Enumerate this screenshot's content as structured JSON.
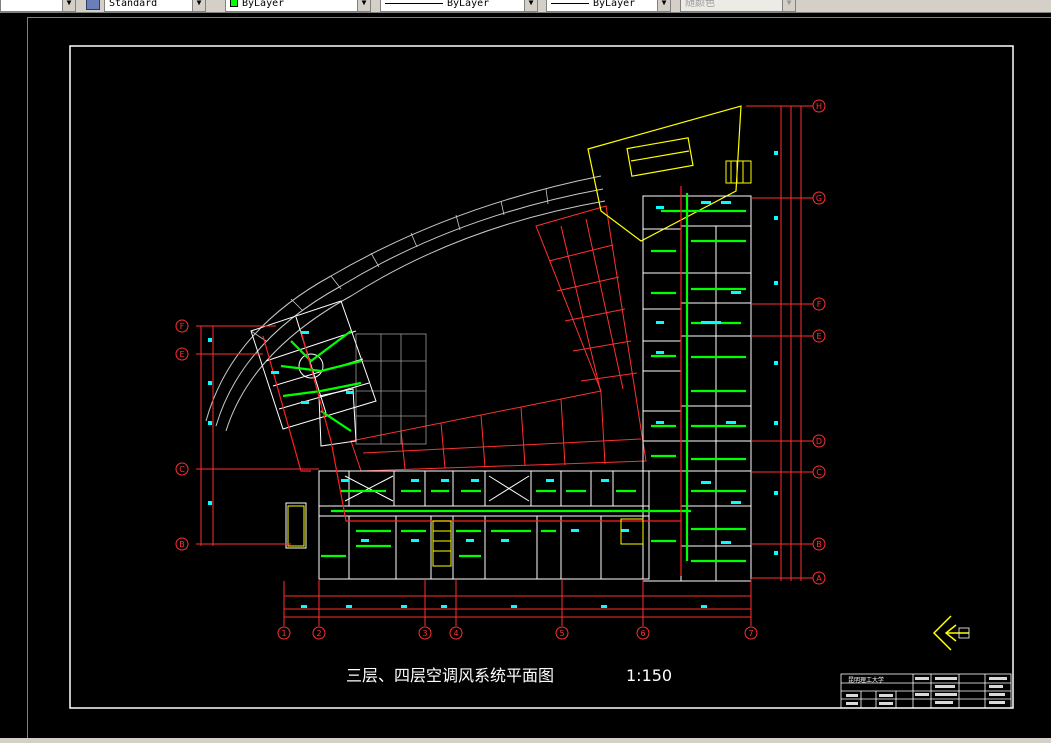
{
  "toolbar": {
    "text_style": "Standard",
    "color": "ByLayer",
    "color_swatch": "#00ff00",
    "linetype": "ByLayer",
    "lineweight": "ByLayer",
    "plot_style": "随颜色"
  },
  "drawing": {
    "title": "三层、四层空调风系统平面图",
    "scale": "1:150",
    "axis_letters_left": [
      "F",
      "E",
      "C",
      "B"
    ],
    "axis_letters_right": [
      "H",
      "G",
      "F",
      "E",
      "D",
      "C",
      "B",
      "A"
    ],
    "axis_numbers_bottom": [
      "1",
      "2",
      "3",
      "4",
      "5",
      "6",
      "7"
    ],
    "title_block": {
      "institution": "昆明理工大学"
    }
  }
}
